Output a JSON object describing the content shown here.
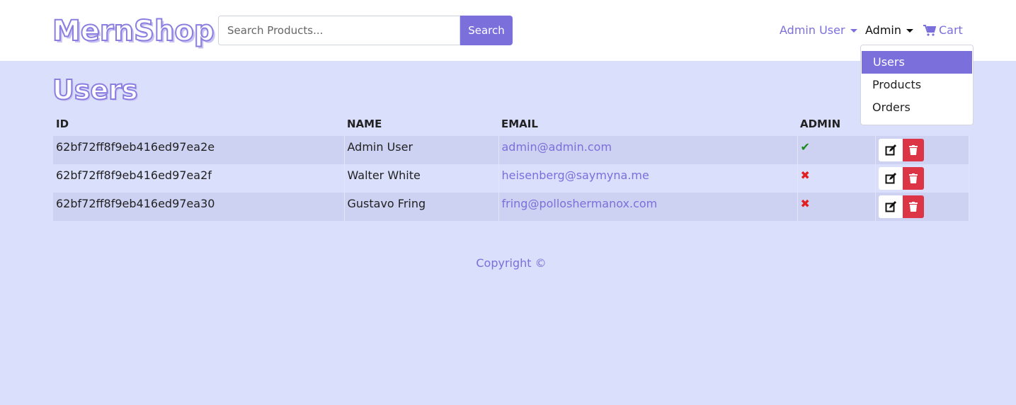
{
  "header": {
    "brand": "MernShop",
    "search": {
      "placeholder": "Search Products...",
      "button_label": "Search"
    },
    "nav": {
      "user_label": "Admin User",
      "admin_label": "Admin",
      "cart_label": "Cart"
    },
    "admin_menu": {
      "items": [
        {
          "label": "Users",
          "active": true
        },
        {
          "label": "Products",
          "active": false
        },
        {
          "label": "Orders",
          "active": false
        }
      ]
    }
  },
  "main": {
    "title": "Users",
    "table": {
      "columns": [
        "ID",
        "NAME",
        "EMAIL",
        "ADMIN",
        ""
      ],
      "rows": [
        {
          "id": "62bf72ff8f9eb416ed97ea2e",
          "name": "Admin User",
          "email": "admin@admin.com",
          "admin": true
        },
        {
          "id": "62bf72ff8f9eb416ed97ea2f",
          "name": "Walter White",
          "email": "heisenberg@saymyna.me",
          "admin": false
        },
        {
          "id": "62bf72ff8f9eb416ed97ea30",
          "name": "Gustavo Fring",
          "email": "fring@polloshermanox.com",
          "admin": false
        }
      ]
    }
  },
  "footer": {
    "text": "Copyright ©"
  },
  "colors": {
    "accent": "#7b6fdb",
    "background": "#dadffc",
    "danger": "#dc3545",
    "success": "#1a8a1a"
  },
  "icons": {
    "cart": "cart-icon",
    "check": "check-icon",
    "cross": "cross-icon",
    "edit": "edit-icon",
    "delete": "trash-icon"
  }
}
